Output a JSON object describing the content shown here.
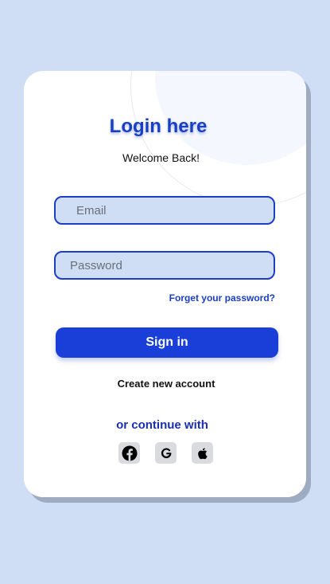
{
  "login": {
    "title": "Login here",
    "subtitle": "Welcome Back!",
    "email_placeholder": "Email",
    "password_placeholder": "Password",
    "forgot_label": "Forget your password?",
    "signin_label": "Sign in",
    "create_label": "Create new account",
    "continue_label": "or continue with"
  },
  "social": [
    {
      "icon": "facebook-icon"
    },
    {
      "icon": "google-icon"
    },
    {
      "icon": "apple-icon"
    }
  ],
  "colors": {
    "background": "#cfdef5",
    "accent": "#1a3fc4",
    "button": "#1a3fd8"
  }
}
